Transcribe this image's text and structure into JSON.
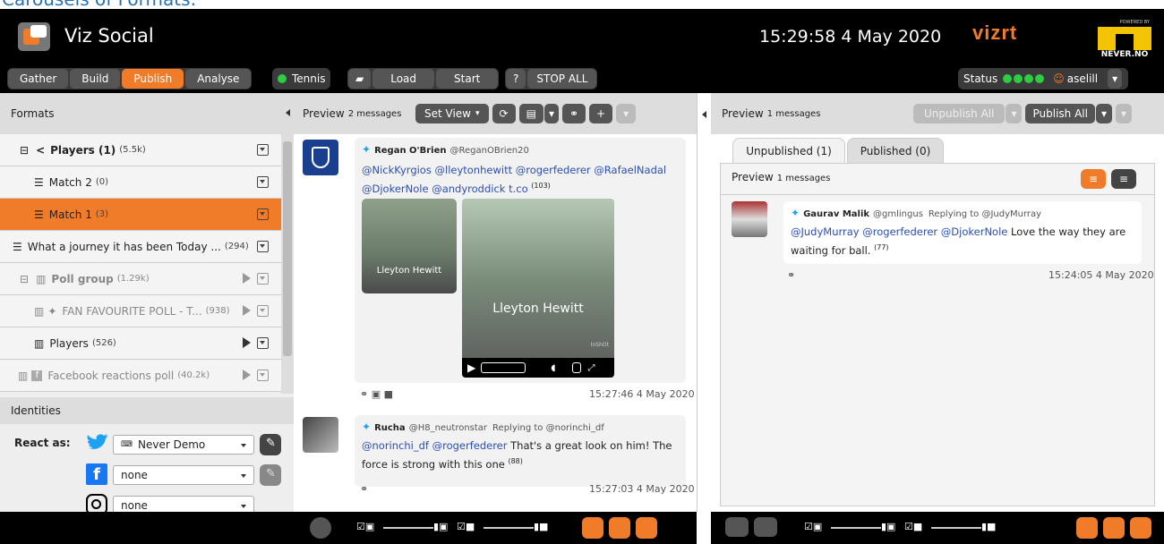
{
  "caption": "Carousels of Formats:",
  "app": {
    "title": "Viz Social",
    "clock": "15:29:58 4 May 2020",
    "brand": "vizrt",
    "powered": "POWERED BY",
    "never": "NEVER.NO"
  },
  "nav": {
    "gather": "Gather",
    "build": "Build",
    "publish": "Publish",
    "analyse": "Analyse",
    "tennis": "Tennis",
    "load": "Load",
    "start": "Start",
    "stop_all": "STOP ALL",
    "status": "Status",
    "user": "aselill"
  },
  "left": {
    "header": "Formats",
    "rows": [
      {
        "label": "Players (1)",
        "count": "(5.5k)"
      },
      {
        "label": "Match 2",
        "count": "(0)"
      },
      {
        "label": "Match 1",
        "count": "(3)"
      },
      {
        "label": "What a journey it has been Today ...",
        "count": "(294)"
      },
      {
        "label": "Poll group",
        "count": "(1.29k)"
      },
      {
        "label": "FAN FAVOURITE POLL - T...",
        "count": "(938)"
      },
      {
        "label": "Players",
        "count": "(526)"
      },
      {
        "label": "Facebook reactions poll",
        "count": "(40.2k)"
      }
    ],
    "identities": "Identities",
    "react_as": "React as:",
    "twitter_account": "Never Demo",
    "facebook_account": "none",
    "instagram_account": "none"
  },
  "middle": {
    "header": "Preview",
    "count": "2 messages",
    "set_view": "Set View",
    "tweets": [
      {
        "name": "Regan O'Brien",
        "handle": "@ReganOBrien20",
        "mentions": "@NickKyrgios @lleytonhewitt @rogerfederer @RafaelNadal @DjokerNole @andyroddick t.co",
        "sup": "(103)",
        "time": "15:27:46 4 May 2020",
        "overlay1": "Lleyton Hewitt",
        "overlay2": "Lleyton Hewitt",
        "watermark": "InShOt"
      },
      {
        "name": "Rucha",
        "handle": "@H8_neutronstar",
        "reply": "Replying to @norinchi_df",
        "mentions": "@norinchi_df @rogerfederer",
        "text": "That's a great look on him! The force is strong with this one",
        "sup": "(88)",
        "time": "15:27:03 4 May 2020"
      }
    ]
  },
  "right": {
    "header": "Preview",
    "count": "1 messages",
    "unpublish_all": "Unpublish All",
    "publish_all": "Publish All",
    "tab_unpublished": "Unpublished (1)",
    "tab_published": "Published (0)",
    "inner_header": "Preview",
    "inner_count": "1 messages",
    "tweet": {
      "name": "Gaurav Malik",
      "handle": "@gmlingus",
      "reply": "Replying to @JudyMurray",
      "mentions": "@JudyMurray @rogerfederer @DjokerNole",
      "text": "Love the way they are waiting for ball.",
      "sup": "(77)",
      "time": "15:24:05 4 May 2020"
    }
  }
}
